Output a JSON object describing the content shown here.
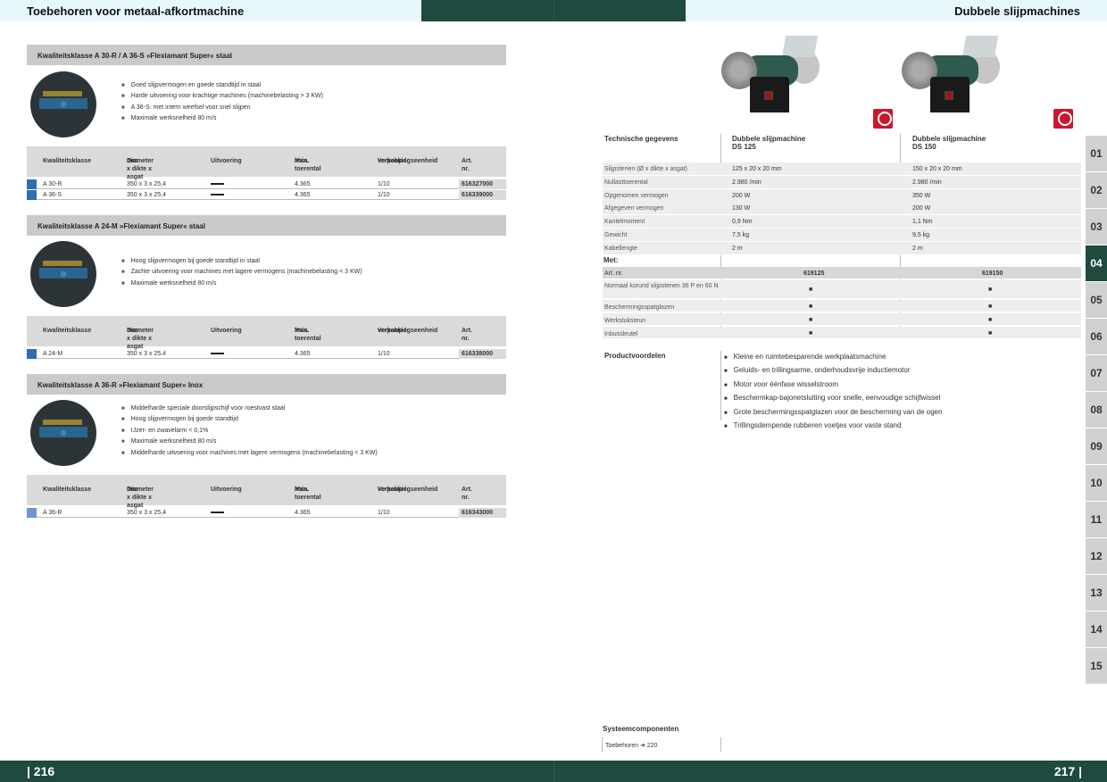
{
  "header": {
    "left_title": "Toebehoren voor metaal-afkortmachine",
    "right_title": "Dubbele slijpmachines"
  },
  "footer": {
    "left_page": "| 216",
    "right_page": "217 |"
  },
  "table_headers": {
    "kwaliteit": "Kwaliteitsklasse",
    "diameter": "Diameter x dikte x asgat",
    "diameter2": "mm",
    "uitvoering": "Uitvoering",
    "toerental": "Max. toerental",
    "toerental2": "/min.",
    "verkoop": "Verkoop-/",
    "verkoop2": "verpakkingseenheid",
    "artnr": "Art. nr."
  },
  "sections": [
    {
      "title": "Kwaliteitsklasse A 30-R / A 36-S »Flexiamant Super« staal",
      "bullets": [
        "Goed slijpvermogen en goede standtijd in staal",
        "Harde uitvoering voor krachtige machines (machinebelasting > 3 KW)",
        "A 36-S: met intern weefsel voor snel slijpen",
        "Maximale werksnelheid 80 m/s"
      ],
      "rows": [
        {
          "color": "#2a6fb3",
          "klasse": "A 30-R",
          "dim": "350 x 3 x 25,4",
          "toer": "4.365",
          "verp": "1/10",
          "art": "616327000"
        },
        {
          "color": "#2a6fb3",
          "klasse": "A 36-S",
          "dim": "350 x 3 x 25,4",
          "toer": "4.365",
          "verp": "1/10",
          "art": "616339000"
        }
      ]
    },
    {
      "title": "Kwaliteitsklasse A 24-M »Flexiamant Super« staal",
      "bullets": [
        "Hoog slijpvermogen bij goede standtijd in staal",
        "Zachte uitvoering voor machines met lagere vermogens (machinebelasting < 3 KW)",
        "Maximale werksnelheid 80 m/s"
      ],
      "rows": [
        {
          "color": "#2a6fb3",
          "klasse": "A 24-M",
          "dim": "350 x 3 x 25,4",
          "toer": "4.365",
          "verp": "1/10",
          "art": "616338000"
        }
      ]
    },
    {
      "title": "Kwaliteitsklasse A 36-R »Flexiamant Super« Inox",
      "bullets": [
        "Middelharde speciale doorslijpschijf voor roestvast staal",
        "Hoog slijpvermogen bij goede standtijd",
        "IJzer- en zwavelarm < 0,1%",
        "Maximale werksnelheid 80 m/s",
        "Middelharde uitvoering voor machines met lagere vermogens (machinebelasting < 3 KW)"
      ],
      "rows": [
        {
          "color": "#6f96c8",
          "klasse": "A 36-R",
          "dim": "350 x 3 x 25,4",
          "toer": "4.365",
          "verp": "1/10",
          "art": "616343000"
        }
      ]
    }
  ],
  "tech": {
    "label": "Technische gegevens",
    "m1": "Dubbele slijpmachine",
    "m1b": "DS 125",
    "m2": "Dubbele slijpmachine",
    "m2b": "DS 150",
    "rows": [
      [
        "Slijpstenen (Ø x dikte x asgat)",
        "125 x 20 x 20 mm",
        "150 x 20 x 20 mm"
      ],
      [
        "Nullasttoerental",
        "2.980 /min",
        "2.980 /min"
      ],
      [
        "Opgenomen vermogen",
        "200 W",
        "350 W"
      ],
      [
        "Afgegeven vermogen",
        "130 W",
        "200 W"
      ],
      [
        "Kantelmoment",
        "0,9 Nm",
        "1,1 Nm"
      ],
      [
        "Gewicht",
        "7,5 kg",
        "9,5 kg"
      ],
      [
        "Kabellengte",
        "2 m",
        "2 m"
      ]
    ]
  },
  "met": {
    "label": "Met:",
    "art_label": "Art. nr.",
    "art1": "619125",
    "art2": "619150",
    "rows": [
      [
        "Normaal korund slijpstenen 36 P en 60 N",
        "■",
        "■"
      ],
      [
        "Beschermingsspatglazen",
        "■",
        "■"
      ],
      [
        "Werkstuksteun",
        "■",
        "■"
      ],
      [
        "Inbussleutel",
        "■",
        "■"
      ]
    ]
  },
  "productvoordelen": {
    "label": "Productvoordelen",
    "items": [
      "Kleine en ruimtebesparende werkplaatsmachine",
      "Geluids- en trillingsarme, onderhoudsvrije inductiemotor",
      "Motor voor éénfase wisselstroom",
      "Beschermkap-bajonetsluiting voor snelle, eenvoudige schijfwissel",
      "Grote beschermingsspatglazen voor de bescherming van de ogen",
      "Trillingsdempende rubberen voetjes voor vaste stand"
    ]
  },
  "systeem": {
    "label": "Systeemcomponenten",
    "item": "Toebehoren",
    "arrow": "➜",
    "page": "220"
  },
  "tabs": [
    "01",
    "02",
    "03",
    "04",
    "05",
    "06",
    "07",
    "08",
    "09",
    "10",
    "11",
    "12",
    "13",
    "14",
    "15"
  ],
  "active_tab": "04"
}
